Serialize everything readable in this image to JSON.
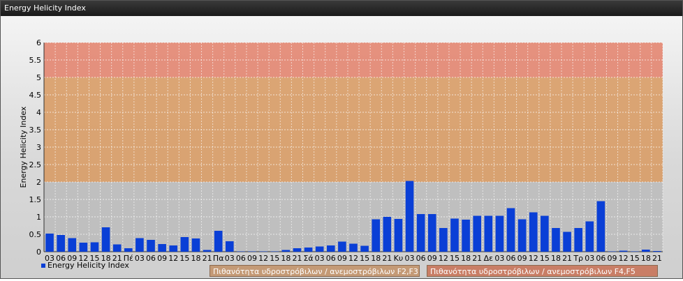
{
  "window": {
    "title": "Energy Helicity Index"
  },
  "colors": {
    "bar": "#0a3fd6",
    "band_low": "#bbbbbb",
    "band_mid": "#d8995f",
    "band_high": "#e3806a"
  },
  "chart_data": {
    "type": "bar",
    "ylabel": "Energy Helicity Index",
    "xlabel": "",
    "ylim": [
      0,
      6
    ],
    "yticks": [
      "0",
      "0.5",
      "1",
      "1.5",
      "2",
      "2.5",
      "3",
      "3.5",
      "4",
      "4.5",
      "5",
      "5.5",
      "6"
    ],
    "categories": [
      "03",
      "06",
      "09",
      "12",
      "15",
      "18",
      "21",
      "Πέ",
      "03",
      "06",
      "09",
      "12",
      "15",
      "18",
      "21",
      "Πα",
      "03",
      "06",
      "09",
      "12",
      "15",
      "18",
      "21",
      "Σά",
      "03",
      "06",
      "09",
      "12",
      "15",
      "18",
      "21",
      "Κυ",
      "03",
      "06",
      "09",
      "12",
      "15",
      "18",
      "21",
      "Δε",
      "03",
      "06",
      "09",
      "12",
      "15",
      "18",
      "21",
      "Τρ",
      "03",
      "06",
      "09",
      "12",
      "15",
      "18",
      "21"
    ],
    "series": [
      {
        "name": "Energy Helicity Index",
        "values": [
          0.52,
          0.48,
          0.39,
          0.26,
          0.27,
          0.7,
          0.21,
          0.1,
          0.39,
          0.34,
          0.22,
          0.18,
          0.42,
          0.38,
          0.05,
          0.6,
          0.3,
          0.01,
          0.01,
          0.01,
          0.01,
          0.05,
          0.1,
          0.12,
          0.15,
          0.18,
          0.29,
          0.23,
          0.17,
          0.93,
          1.0,
          0.94,
          2.03,
          1.08,
          1.08,
          0.68,
          0.95,
          0.92,
          1.03,
          1.03,
          1.03,
          1.25,
          0.93,
          1.13,
          1.03,
          0.68,
          0.57,
          0.68,
          0.87,
          1.45,
          0.01,
          0.03,
          0.01,
          0.06,
          0.02
        ]
      }
    ],
    "bands": [
      {
        "from": 0,
        "to": 2,
        "label": ""
      },
      {
        "from": 2,
        "to": 5,
        "label": "Πιθανότητα υδροστρόβιλων / ανεμοστρόβιλων F2,F3"
      },
      {
        "from": 5,
        "to": 6,
        "label": "Πιθανότητα υδροστρόβιλων / ανεμοστρόβιλων F4,F5"
      }
    ],
    "legend": "bottom-left"
  }
}
